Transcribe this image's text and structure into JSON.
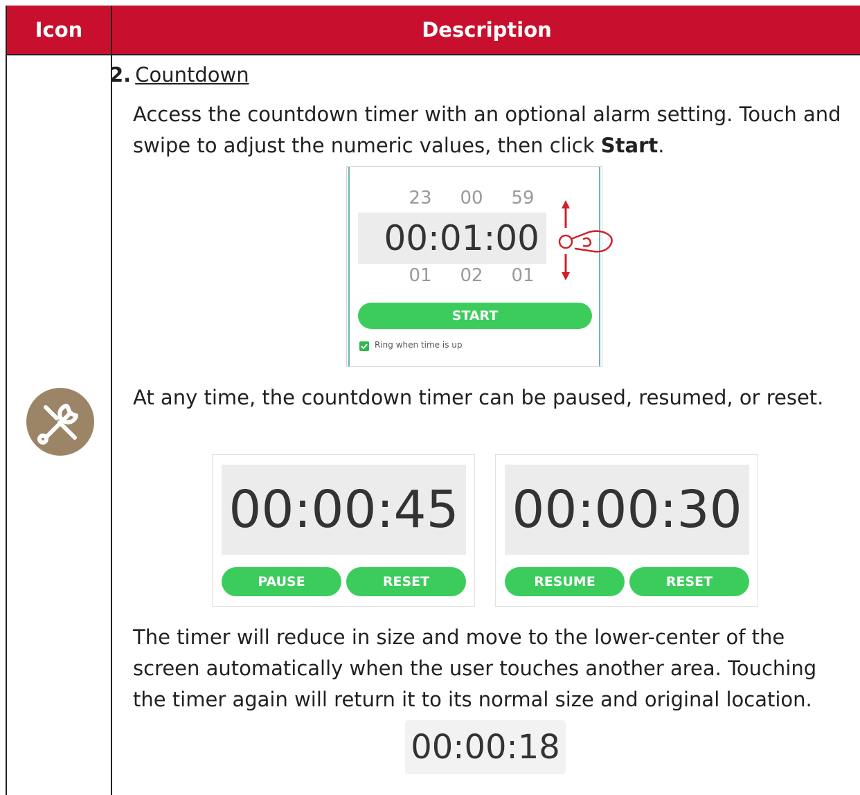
{
  "header": {
    "icon_col": "Icon",
    "desc_col": "Description"
  },
  "icon": {
    "name": "tools"
  },
  "item": {
    "number": "2.",
    "title": "Countdown",
    "intro_pre": "Access the countdown timer with an optional alarm setting. Touch and swipe to adjust the numeric values, then click ",
    "intro_bold": "Start",
    "intro_post": ".",
    "pause_text": "At any time, the countdown timer can be paused, resumed, or reset.",
    "reduce_text": "The timer will reduce in size and move to the lower-center of the screen automatically when the user touches another area. Touching the timer again will return it to its normal size and original location."
  },
  "picker": {
    "above": [
      "23",
      "00",
      "59"
    ],
    "current": "00:01:00",
    "below": [
      "01",
      "02",
      "01"
    ],
    "start_label": "START",
    "ring_label": "Ring when time is up",
    "ring_checked": true
  },
  "paused_timer": {
    "time": "00:00:45",
    "btn_a": "PAUSE",
    "btn_b": "RESET"
  },
  "resumed_timer": {
    "time": "00:00:30",
    "btn_a": "RESUME",
    "btn_b": "RESET"
  },
  "mini_timer": {
    "time": "00:00:18"
  },
  "colors": {
    "header_bg": "#c8102e",
    "accent_green": "#3ccc5c",
    "icon_bg": "#9c8466",
    "arrow_red": "#d0202a"
  }
}
